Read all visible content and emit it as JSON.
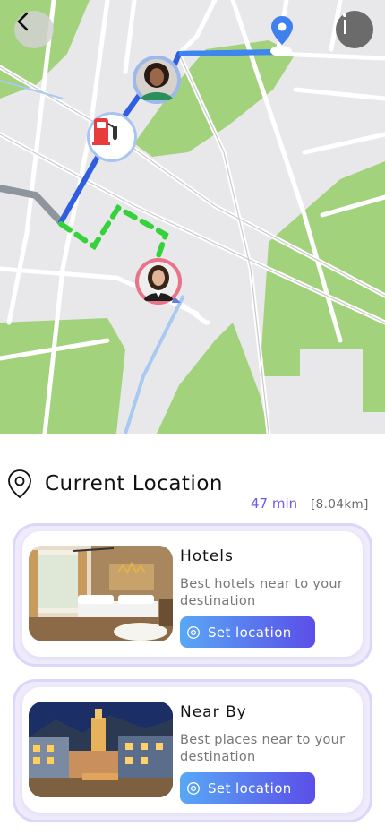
{
  "map": {
    "back_icon": "chevron-left-icon",
    "info_icon": "info-icon",
    "pin_icon": "location-pin-icon",
    "fuel_icon": "fuel-pump-icon"
  },
  "location": {
    "title": "Current Location",
    "eta": "47 min",
    "distance": "[8.04km]",
    "icon": "location-pin-outline-icon"
  },
  "cards": [
    {
      "title": "Hotels",
      "description": "Best hotels near to your destination",
      "button_label": "Set location"
    },
    {
      "title": "Near By",
      "description": "Best places near to your destination",
      "button_label": "Set location"
    }
  ],
  "colors": {
    "accent": "#6c5ce7",
    "route_blue": "#2f5fe0",
    "route_green": "#35d23b",
    "map_green": "#9fd27a"
  }
}
